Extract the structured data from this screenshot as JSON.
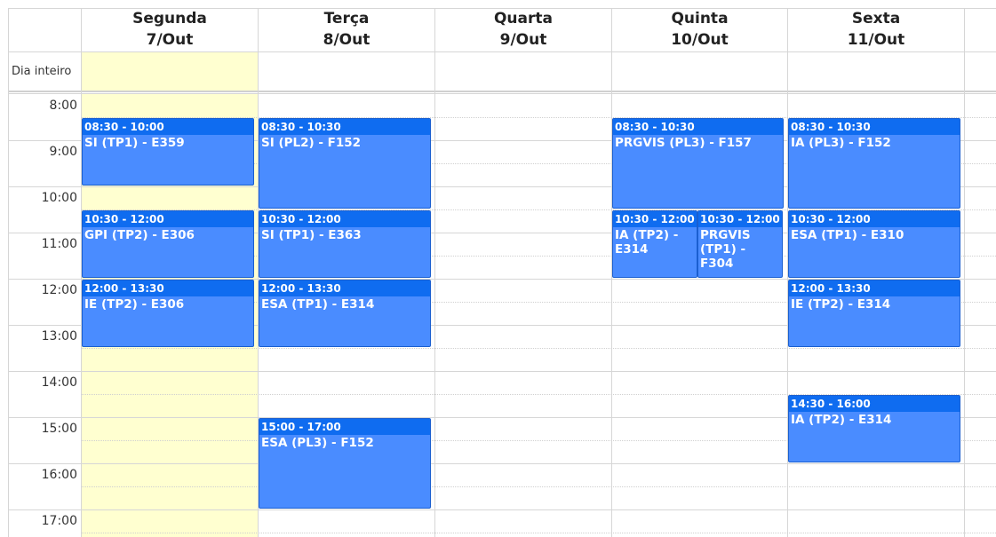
{
  "days": [
    {
      "name": "Segunda",
      "date": "7/Out"
    },
    {
      "name": "Terça",
      "date": "8/Out"
    },
    {
      "name": "Quarta",
      "date": "9/Out"
    },
    {
      "name": "Quinta",
      "date": "10/Out"
    },
    {
      "name": "Sexta",
      "date": "11/Out"
    }
  ],
  "all_day_label": "Dia inteiro",
  "times": [
    "8:00",
    "9:00",
    "10:00",
    "11:00",
    "12:00",
    "13:00",
    "14:00",
    "15:00",
    "16:00",
    "17:00"
  ],
  "colors": {
    "event_bg": "#4a8cff",
    "event_header": "#0f6cf0",
    "today_bg": "#ffffd0"
  },
  "events": [
    {
      "day": 0,
      "time": "08:30 - 10:00",
      "title": "SI (TP1) - E359"
    },
    {
      "day": 0,
      "time": "10:30 - 12:00",
      "title": "GPI (TP2) - E306"
    },
    {
      "day": 0,
      "time": "12:00 - 13:30",
      "title": "IE (TP2) - E306"
    },
    {
      "day": 1,
      "time": "08:30 - 10:30",
      "title": "SI (PL2) - F152"
    },
    {
      "day": 1,
      "time": "10:30 - 12:00",
      "title": "SI (TP1) - E363"
    },
    {
      "day": 1,
      "time": "12:00 - 13:30",
      "title": "ESA (TP1) - E314"
    },
    {
      "day": 1,
      "time": "15:00 - 17:00",
      "title": "ESA (PL3) - F152"
    },
    {
      "day": 3,
      "time": "08:30 - 10:30",
      "title": "PRGVIS (PL3) - F157"
    },
    {
      "day": 3,
      "time": "10:30 - 12:00",
      "title": "IA (TP2) - E314",
      "half": 0
    },
    {
      "day": 3,
      "time": "10:30 - 12:00",
      "title": "PRGVIS (TP1) - F304",
      "half": 1
    },
    {
      "day": 4,
      "time": "08:30 - 10:30",
      "title": "IA (PL3) - F152"
    },
    {
      "day": 4,
      "time": "10:30 - 12:00",
      "title": "ESA (TP1) - E310"
    },
    {
      "day": 4,
      "time": "12:00 - 13:30",
      "title": "IE (TP2) - E314"
    },
    {
      "day": 4,
      "time": "14:30 - 16:00",
      "title": "IA (TP2) - E314"
    }
  ]
}
